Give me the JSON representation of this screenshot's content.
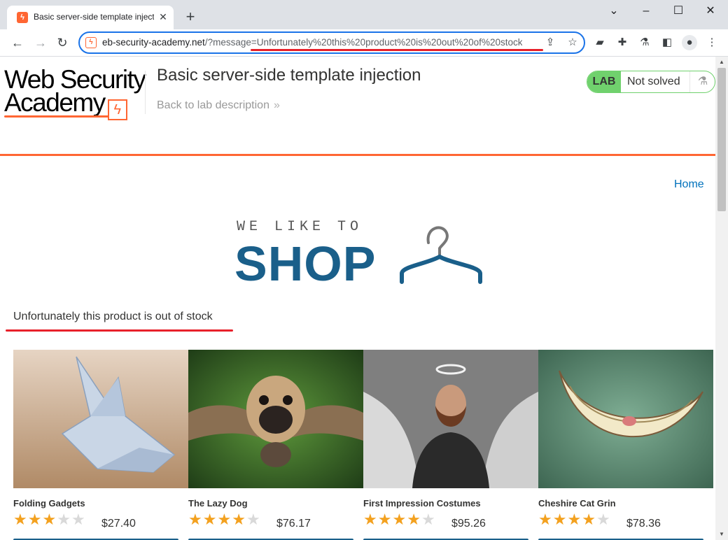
{
  "browser": {
    "tab_title": "Basic server-side template injection",
    "tab_favicon": "web-security-academy-favicon",
    "new_tab_label": "+",
    "url_host": "eb-security-academy.net",
    "url_path": "/?message=Unfortunately%20this%20product%20is%20out%20of%20stock",
    "controls": {
      "minimize": "–",
      "maximize": "☐",
      "close": "✕",
      "tab_list": "⌄"
    },
    "nav": {
      "back": "←",
      "forward": "→",
      "reload": "↻"
    }
  },
  "lab": {
    "logo_line1": "Web Security",
    "logo_line2": "Academy",
    "logo_bolt": "ϟ",
    "title": "Basic server-side template injection",
    "back_link": "Back to lab description",
    "back_chevron": "»",
    "badge": "LAB",
    "status": "Not solved",
    "status_color": "#70d16d",
    "accent_color": "#ff6633"
  },
  "nav": {
    "home": "Home"
  },
  "shop": {
    "tagline": "WE LIKE TO",
    "word": "SHOP"
  },
  "message": "Unfortunately this product is out of stock",
  "products": [
    {
      "name": "Folding Gadgets",
      "rating": 3,
      "price": "$27.40"
    },
    {
      "name": "The Lazy Dog",
      "rating": 4,
      "price": "$76.17"
    },
    {
      "name": "First Impression Costumes",
      "rating": 4,
      "price": "$95.26"
    },
    {
      "name": "Cheshire Cat Grin",
      "rating": 4,
      "price": "$78.36"
    }
  ]
}
